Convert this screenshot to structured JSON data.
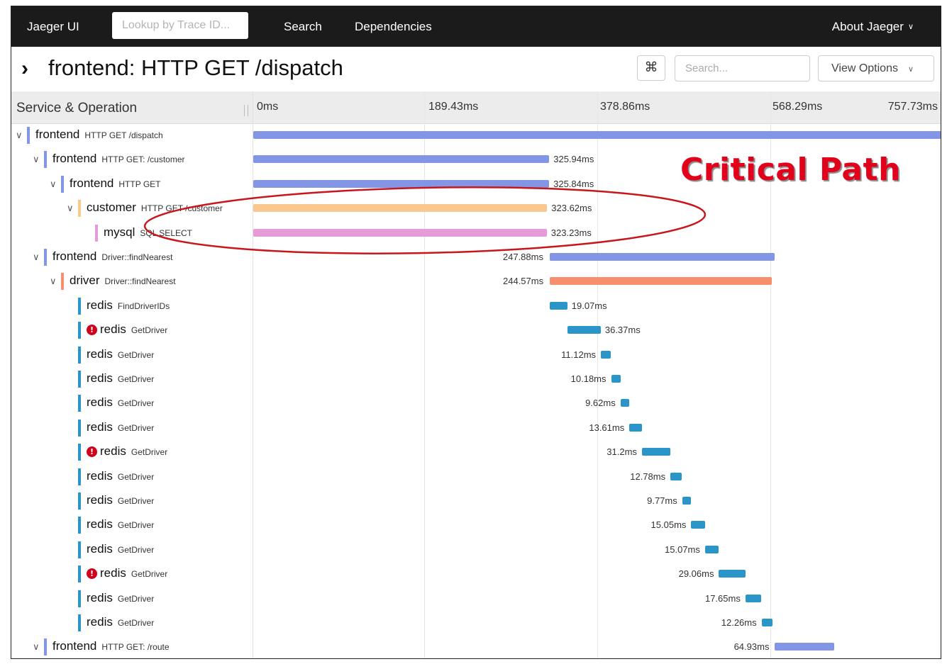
{
  "nav": {
    "brand": "Jaeger UI",
    "lookup_placeholder": "Lookup by Trace ID...",
    "search": "Search",
    "dependencies": "Dependencies",
    "about": "About Jaeger"
  },
  "trace": {
    "expand_glyph": "›",
    "title": "frontend: HTTP GET /dispatch",
    "shortcut_icon": "⌘",
    "search_placeholder": "Search...",
    "view_options": "View Options"
  },
  "header": {
    "service_operation": "Service & Operation",
    "ticks": [
      "0ms",
      "189.43ms",
      "378.86ms",
      "568.29ms",
      "757.73ms"
    ]
  },
  "annotation": {
    "label": "Critical Path"
  },
  "colors": {
    "frontend": "#8396e6",
    "customer": "#f9c88e",
    "mysql": "#e79ad8",
    "driver": "#f78f6e",
    "redis": "#2a95c9",
    "error": "#d0021b",
    "annotation": "#e3001b"
  },
  "spans": [
    {
      "service": "frontend",
      "operation": "HTTP GET /dispatch",
      "depth": 0,
      "toggle": "expanded",
      "error": false,
      "start_ms": 0,
      "duration_ms": 757.73,
      "duration_label": ""
    },
    {
      "service": "frontend",
      "operation": "HTTP GET: /customer",
      "depth": 1,
      "toggle": "expanded",
      "error": false,
      "start_ms": 0,
      "duration_ms": 325.94,
      "duration_label": "325.94ms"
    },
    {
      "service": "frontend",
      "operation": "HTTP GET",
      "depth": 2,
      "toggle": "expanded",
      "error": false,
      "start_ms": 0,
      "duration_ms": 325.84,
      "duration_label": "325.84ms"
    },
    {
      "service": "customer",
      "operation": "HTTP GET /customer",
      "depth": 3,
      "toggle": "expanded",
      "error": false,
      "start_ms": 0,
      "duration_ms": 323.62,
      "duration_label": "323.62ms"
    },
    {
      "service": "mysql",
      "operation": "SQL SELECT",
      "depth": 4,
      "toggle": "none",
      "error": false,
      "start_ms": 0,
      "duration_ms": 323.23,
      "duration_label": "323.23ms"
    },
    {
      "service": "frontend",
      "operation": "Driver::findNearest",
      "depth": 1,
      "toggle": "expanded",
      "error": false,
      "start_ms": 326.5,
      "duration_ms": 247.88,
      "duration_label": "247.88ms"
    },
    {
      "service": "driver",
      "operation": "Driver::findNearest",
      "depth": 2,
      "toggle": "expanded",
      "error": false,
      "start_ms": 326.6,
      "duration_ms": 244.57,
      "duration_label": "244.57ms"
    },
    {
      "service": "redis",
      "operation": "FindDriverIDs",
      "depth": 3,
      "toggle": "none",
      "error": false,
      "start_ms": 326.8,
      "duration_ms": 19.07,
      "duration_label": "19.07ms"
    },
    {
      "service": "redis",
      "operation": "GetDriver",
      "depth": 3,
      "toggle": "none",
      "error": true,
      "start_ms": 346.3,
      "duration_ms": 36.37,
      "duration_label": "36.37ms"
    },
    {
      "service": "redis",
      "operation": "GetDriver",
      "depth": 3,
      "toggle": "none",
      "error": false,
      "start_ms": 382.8,
      "duration_ms": 11.12,
      "duration_label": "11.12ms"
    },
    {
      "service": "redis",
      "operation": "GetDriver",
      "depth": 3,
      "toggle": "none",
      "error": false,
      "start_ms": 394.1,
      "duration_ms": 10.18,
      "duration_label": "10.18ms"
    },
    {
      "service": "redis",
      "operation": "GetDriver",
      "depth": 3,
      "toggle": "none",
      "error": false,
      "start_ms": 404.4,
      "duration_ms": 9.62,
      "duration_label": "9.62ms"
    },
    {
      "service": "redis",
      "operation": "GetDriver",
      "depth": 3,
      "toggle": "none",
      "error": false,
      "start_ms": 414.2,
      "duration_ms": 13.61,
      "duration_label": "13.61ms"
    },
    {
      "service": "redis",
      "operation": "GetDriver",
      "depth": 3,
      "toggle": "none",
      "error": true,
      "start_ms": 428.0,
      "duration_ms": 31.2,
      "duration_label": "31.2ms"
    },
    {
      "service": "redis",
      "operation": "GetDriver",
      "depth": 3,
      "toggle": "none",
      "error": false,
      "start_ms": 459.4,
      "duration_ms": 12.78,
      "duration_label": "12.78ms"
    },
    {
      "service": "redis",
      "operation": "GetDriver",
      "depth": 3,
      "toggle": "none",
      "error": false,
      "start_ms": 472.4,
      "duration_ms": 9.77,
      "duration_label": "9.77ms"
    },
    {
      "service": "redis",
      "operation": "GetDriver",
      "depth": 3,
      "toggle": "none",
      "error": false,
      "start_ms": 482.3,
      "duration_ms": 15.05,
      "duration_label": "15.05ms"
    },
    {
      "service": "redis",
      "operation": "GetDriver",
      "depth": 3,
      "toggle": "none",
      "error": false,
      "start_ms": 497.5,
      "duration_ms": 15.07,
      "duration_label": "15.07ms"
    },
    {
      "service": "redis",
      "operation": "GetDriver",
      "depth": 3,
      "toggle": "none",
      "error": true,
      "start_ms": 512.8,
      "duration_ms": 29.06,
      "duration_label": "29.06ms"
    },
    {
      "service": "redis",
      "operation": "GetDriver",
      "depth": 3,
      "toggle": "none",
      "error": false,
      "start_ms": 542.0,
      "duration_ms": 17.65,
      "duration_label": "17.65ms"
    },
    {
      "service": "redis",
      "operation": "GetDriver",
      "depth": 3,
      "toggle": "none",
      "error": false,
      "start_ms": 559.8,
      "duration_ms": 12.26,
      "duration_label": "12.26ms"
    },
    {
      "service": "frontend",
      "operation": "HTTP GET: /route",
      "depth": 1,
      "toggle": "expanded",
      "error": false,
      "start_ms": 574.5,
      "duration_ms": 64.93,
      "duration_label": "64.93ms"
    }
  ]
}
